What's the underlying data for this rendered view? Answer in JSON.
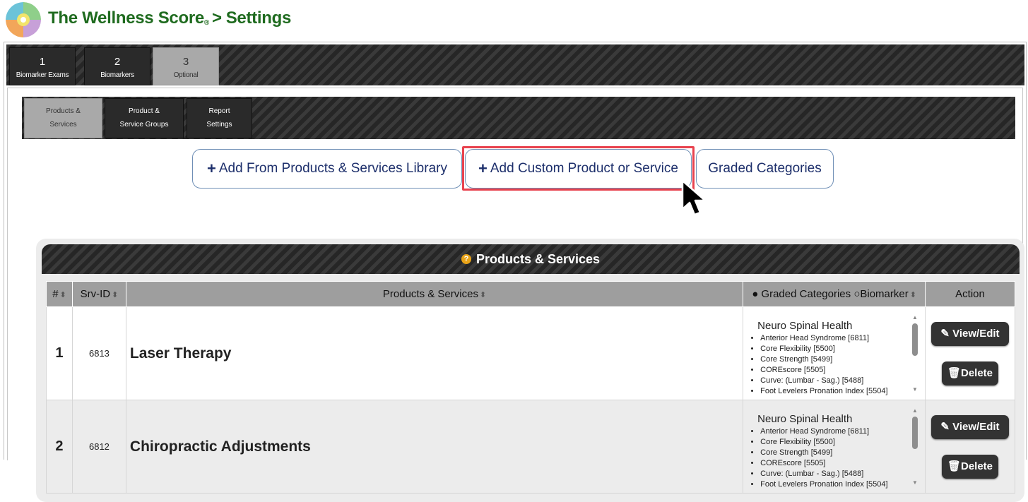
{
  "header": {
    "app_name": "The Wellness Score",
    "registered": "®",
    "separator": ">",
    "page": "Settings"
  },
  "steps": [
    {
      "num": "1",
      "label": "Biomarker Exams",
      "active": false
    },
    {
      "num": "2",
      "label": "Biomarkers",
      "active": false
    },
    {
      "num": "3",
      "label": "Optional",
      "active": true
    }
  ],
  "subtabs": [
    {
      "line1": "Products &",
      "line2": "Services",
      "active": true
    },
    {
      "line1": "Product &",
      "line2": "Service Groups",
      "active": false
    },
    {
      "line1": "Report",
      "line2": "Settings",
      "active": false
    }
  ],
  "actions": {
    "add_library": "Add From Products & Services Library",
    "add_custom": "Add Custom Product or Service",
    "graded_categories": "Graded Categories",
    "plus": "+"
  },
  "panel": {
    "title": "Products & Services",
    "help_icon": "?",
    "columns": {
      "num": "#",
      "srv_id": "Srv-ID",
      "name": "Products & Services",
      "graded": "● Graded Categories ○Biomarker",
      "action": "Action"
    },
    "view_edit_label": "View/Edit",
    "delete_label": "Delete",
    "rows": [
      {
        "num": "1",
        "srv_id": "6813",
        "name": "Laser Therapy",
        "category": "Neuro Spinal Health",
        "items": [
          "Anterior Head Syndrome [6811]",
          "Core Flexibility [5500]",
          "Core Strength [5499]",
          "COREscore [5505]",
          "Curve: (Lumbar - Sag.) [5488]",
          "Foot Levelers Pronation Index [5504]"
        ]
      },
      {
        "num": "2",
        "srv_id": "6812",
        "name": "Chiropractic Adjustments",
        "category": "Neuro Spinal Health",
        "items": [
          "Anterior Head Syndrome [6811]",
          "Core Flexibility [5500]",
          "Core Strength [5499]",
          "COREscore [5505]",
          "Curve: (Lumbar - Sag.) [5488]",
          "Foot Levelers Pronation Index [5504]"
        ]
      }
    ]
  },
  "colors": {
    "brand_green": "#1f6b1f",
    "button_text": "#1d2f6b",
    "highlight_red": "#e8424e",
    "help_orange": "#e8a317"
  },
  "icons": {
    "sort": "sort-icon",
    "edit": "edit-icon",
    "trash": "trash-icon",
    "logo": "wellness-puzzle-logo"
  }
}
